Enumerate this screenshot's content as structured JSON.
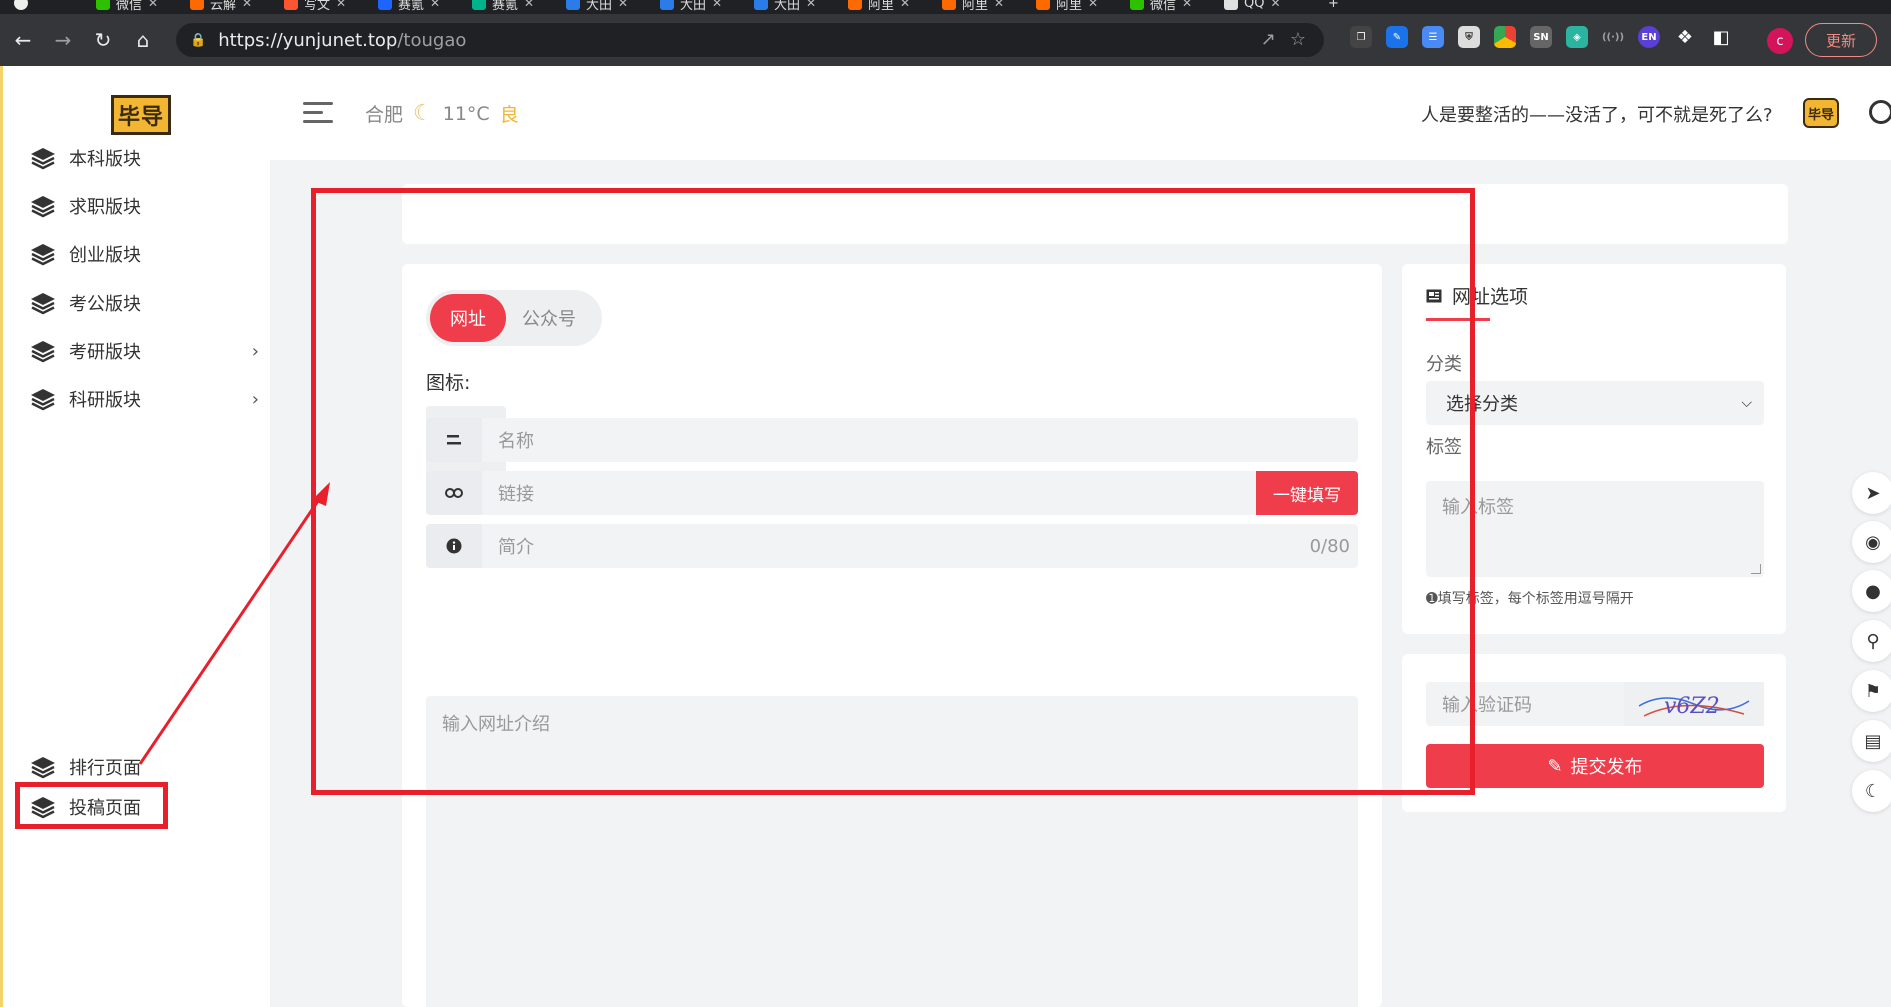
{
  "browser": {
    "tabs": [
      {
        "label": "微信",
        "color": "#2dc100"
      },
      {
        "label": "云解",
        "color": "#ff6a00"
      },
      {
        "label": "写文",
        "color": "#fc5531"
      },
      {
        "label": "赛氪",
        "color": "#1e64ff"
      },
      {
        "label": "赛氪",
        "color": "#00b38a"
      },
      {
        "label": "大田",
        "color": "#2b7ce9"
      },
      {
        "label": "大田",
        "color": "#2b7ce9"
      },
      {
        "label": "大田",
        "color": "#2b7ce9"
      },
      {
        "label": "阿里",
        "color": "#ff6a00"
      },
      {
        "label": "阿里",
        "color": "#ff6a00"
      },
      {
        "label": "阿里",
        "color": "#ff6a00"
      },
      {
        "label": "微信",
        "color": "#2dc100"
      },
      {
        "label": "QQ",
        "color": "#e0e0e0"
      }
    ],
    "url_host": "https://yunjunet.top",
    "url_path": "/tougao",
    "update_label": "更新",
    "profile_initial": "c"
  },
  "header": {
    "logo_text": "毕导",
    "city": "合肥",
    "temperature": "11°C",
    "aqi": "良",
    "motto": "人是要整活的——没活了，可不就是死了么?",
    "small_logo_text": "毕导"
  },
  "sidebar": {
    "items": [
      {
        "label": "本科版块",
        "has_children": false
      },
      {
        "label": "求职版块",
        "has_children": false
      },
      {
        "label": "创业版块",
        "has_children": false
      },
      {
        "label": "考公版块",
        "has_children": false
      },
      {
        "label": "考研版块",
        "has_children": true
      },
      {
        "label": "科研版块",
        "has_children": true
      }
    ],
    "bottom_items": [
      {
        "label": "排行页面"
      },
      {
        "label": "投稿页面"
      }
    ]
  },
  "form": {
    "tab_active": "网址",
    "tab_inactive": "公众号",
    "icon_label": "图标:",
    "name_placeholder": "名称",
    "link_placeholder": "链接",
    "autofill_label": "一键填写",
    "intro_placeholder": "简介",
    "intro_counter": "0/80",
    "description_placeholder": "输入网址介绍"
  },
  "options": {
    "title": "网址选项",
    "category_label": "分类",
    "category_selected": "选择分类",
    "tags_label": "标签",
    "tags_placeholder": "输入标签",
    "tags_hint": "填写标签，每个标签用逗号隔开",
    "captcha_placeholder": "输入验证码",
    "captcha_text": "v6Z2",
    "submit_label": "提交发布"
  },
  "colors": {
    "accent": "#ef3d4b",
    "annotation": "#e8202c"
  }
}
